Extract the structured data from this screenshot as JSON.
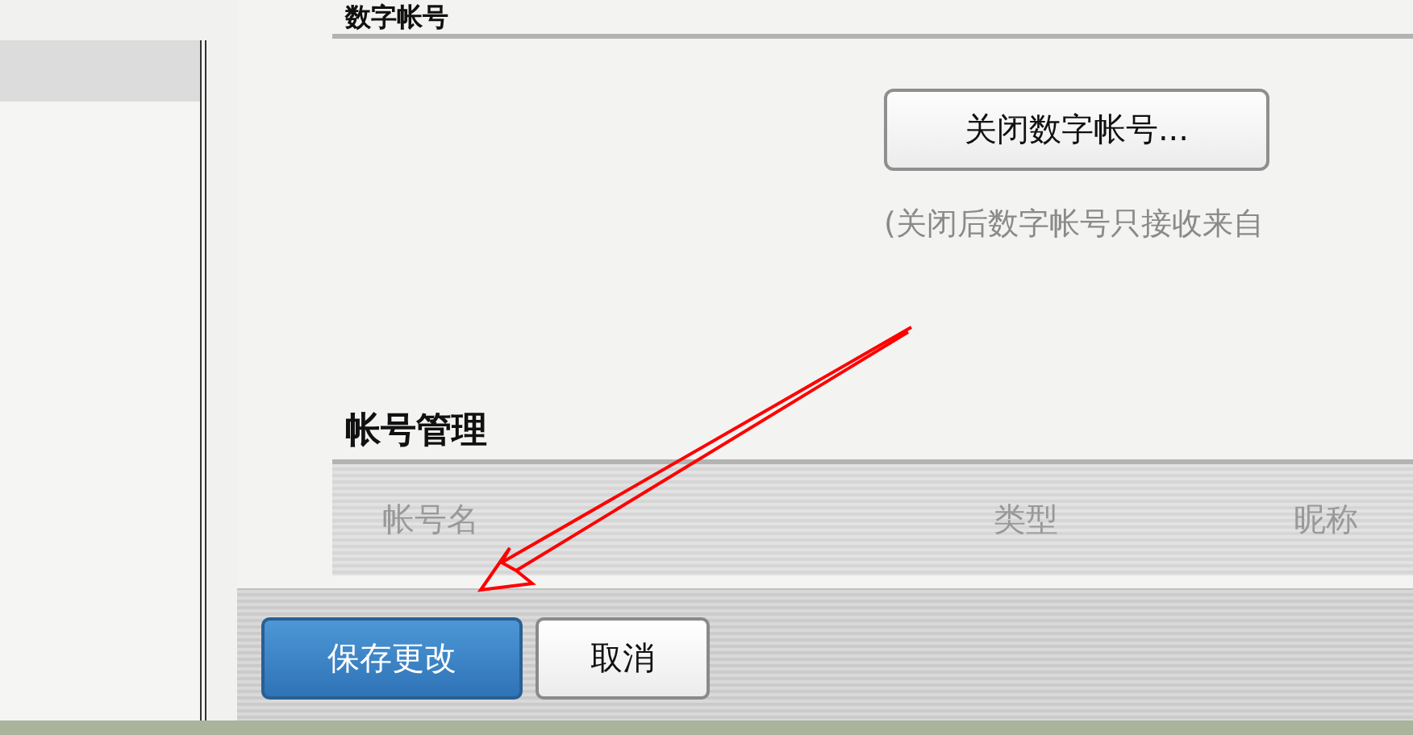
{
  "digital_account": {
    "title": "数字帐号",
    "button": "关闭数字帐号...",
    "hint": "(关闭后数字帐号只接收来自"
  },
  "account_management": {
    "title": "帐号管理",
    "columns": [
      "帐号名",
      "类型",
      "昵称"
    ]
  },
  "actions": [
    {
      "label": "保存更改",
      "primary": true
    },
    {
      "label": "取消",
      "primary": false
    }
  ]
}
